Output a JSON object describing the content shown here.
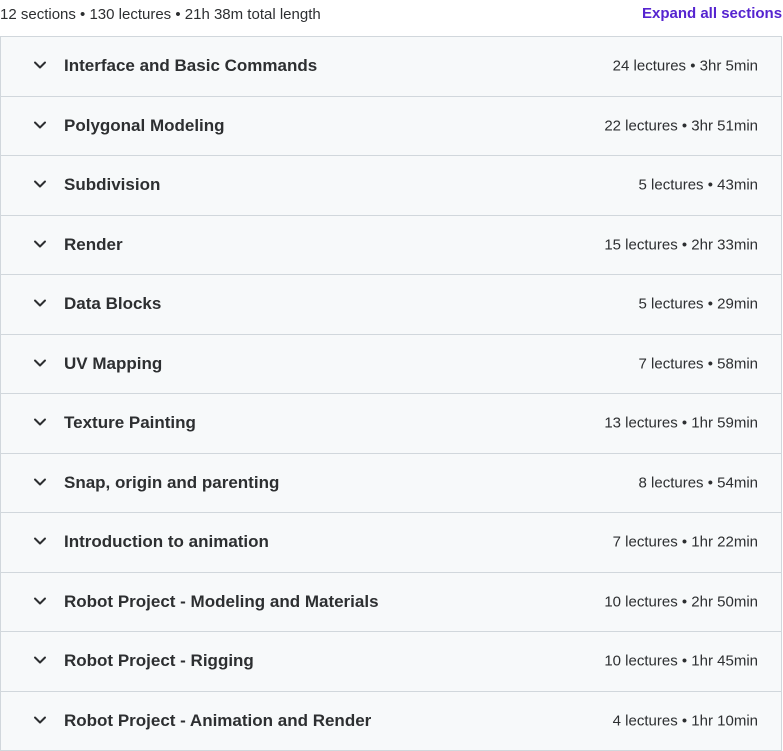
{
  "curriculum": {
    "summary": "12 sections • 130 lectures • 21h 38m total length",
    "expand_all_label": "Expand all sections",
    "sections": [
      {
        "title": "Interface and Basic Commands",
        "meta": "24 lectures • 3hr 5min"
      },
      {
        "title": "Polygonal Modeling",
        "meta": "22 lectures • 3hr 51min"
      },
      {
        "title": "Subdivision",
        "meta": "5 lectures • 43min"
      },
      {
        "title": "Render",
        "meta": "15 lectures • 2hr 33min"
      },
      {
        "title": "Data Blocks",
        "meta": "5 lectures • 29min"
      },
      {
        "title": "UV Mapping",
        "meta": "7 lectures • 58min"
      },
      {
        "title": "Texture Painting",
        "meta": "13 lectures • 1hr 59min"
      },
      {
        "title": "Snap, origin and parenting",
        "meta": "8 lectures • 54min"
      },
      {
        "title": "Introduction to animation",
        "meta": "7 lectures • 1hr 22min"
      },
      {
        "title": "Robot Project - Modeling and Materials",
        "meta": "10 lectures • 2hr 50min"
      },
      {
        "title": "Robot Project - Rigging",
        "meta": "10 lectures • 1hr 45min"
      },
      {
        "title": "Robot Project - Animation and Render",
        "meta": "4 lectures • 1hr 10min"
      }
    ],
    "chevron_icon": "chevron-down-icon",
    "colors": {
      "accent": "#5624d0",
      "text": "#2d2f31",
      "section_bg": "#f7f9fa",
      "border": "#d1d7dc"
    }
  }
}
